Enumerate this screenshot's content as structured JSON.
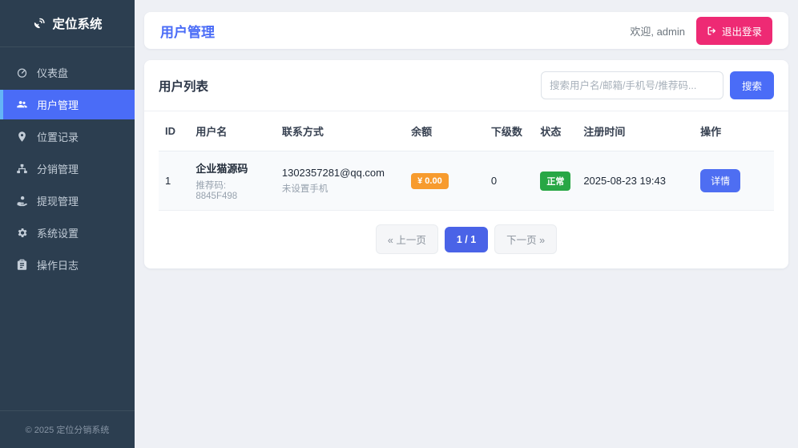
{
  "app": {
    "title": "定位系统",
    "footer": "© 2025 定位分销系统"
  },
  "sidebar": {
    "items": [
      {
        "label": "仪表盘",
        "icon": "gauge-icon",
        "active": false
      },
      {
        "label": "用户管理",
        "icon": "users-icon",
        "active": true
      },
      {
        "label": "位置记录",
        "icon": "map-marker-icon",
        "active": false
      },
      {
        "label": "分销管理",
        "icon": "sitemap-icon",
        "active": false
      },
      {
        "label": "提现管理",
        "icon": "hand-coin-icon",
        "active": false
      },
      {
        "label": "系统设置",
        "icon": "gears-icon",
        "active": false
      },
      {
        "label": "操作日志",
        "icon": "clipboard-icon",
        "active": false
      }
    ]
  },
  "header": {
    "title": "用户管理",
    "welcome": "欢迎, admin",
    "logout_label": "退出登录"
  },
  "list_card": {
    "title": "用户列表",
    "search_placeholder": "搜索用户名/邮箱/手机号/推荐码...",
    "search_button": "搜索"
  },
  "table": {
    "columns": [
      "ID",
      "用户名",
      "联系方式",
      "余额",
      "下级数",
      "状态",
      "注册时间",
      "操作"
    ],
    "rows": [
      {
        "id": "1",
        "username": "企业猫源码",
        "referral": "推荐码: 8845F498",
        "email": "1302357281@qq.com",
        "phone": "未设置手机",
        "balance": "¥ 0.00",
        "subordinates": "0",
        "status": "正常",
        "registered": "2025-08-23 19:43",
        "action": "详情"
      }
    ]
  },
  "pagination": {
    "prev": "« 上一页",
    "current": "1 / 1",
    "next": "下一页 »"
  },
  "colors": {
    "sidebar_bg": "#2c3e50",
    "accent_blue": "#4a6cf7",
    "active_border": "#64b5f6",
    "logout_pink": "#ee2a74",
    "balance_orange": "#f79b2e",
    "status_green": "#28a745",
    "page_bg": "#eef0f5"
  }
}
